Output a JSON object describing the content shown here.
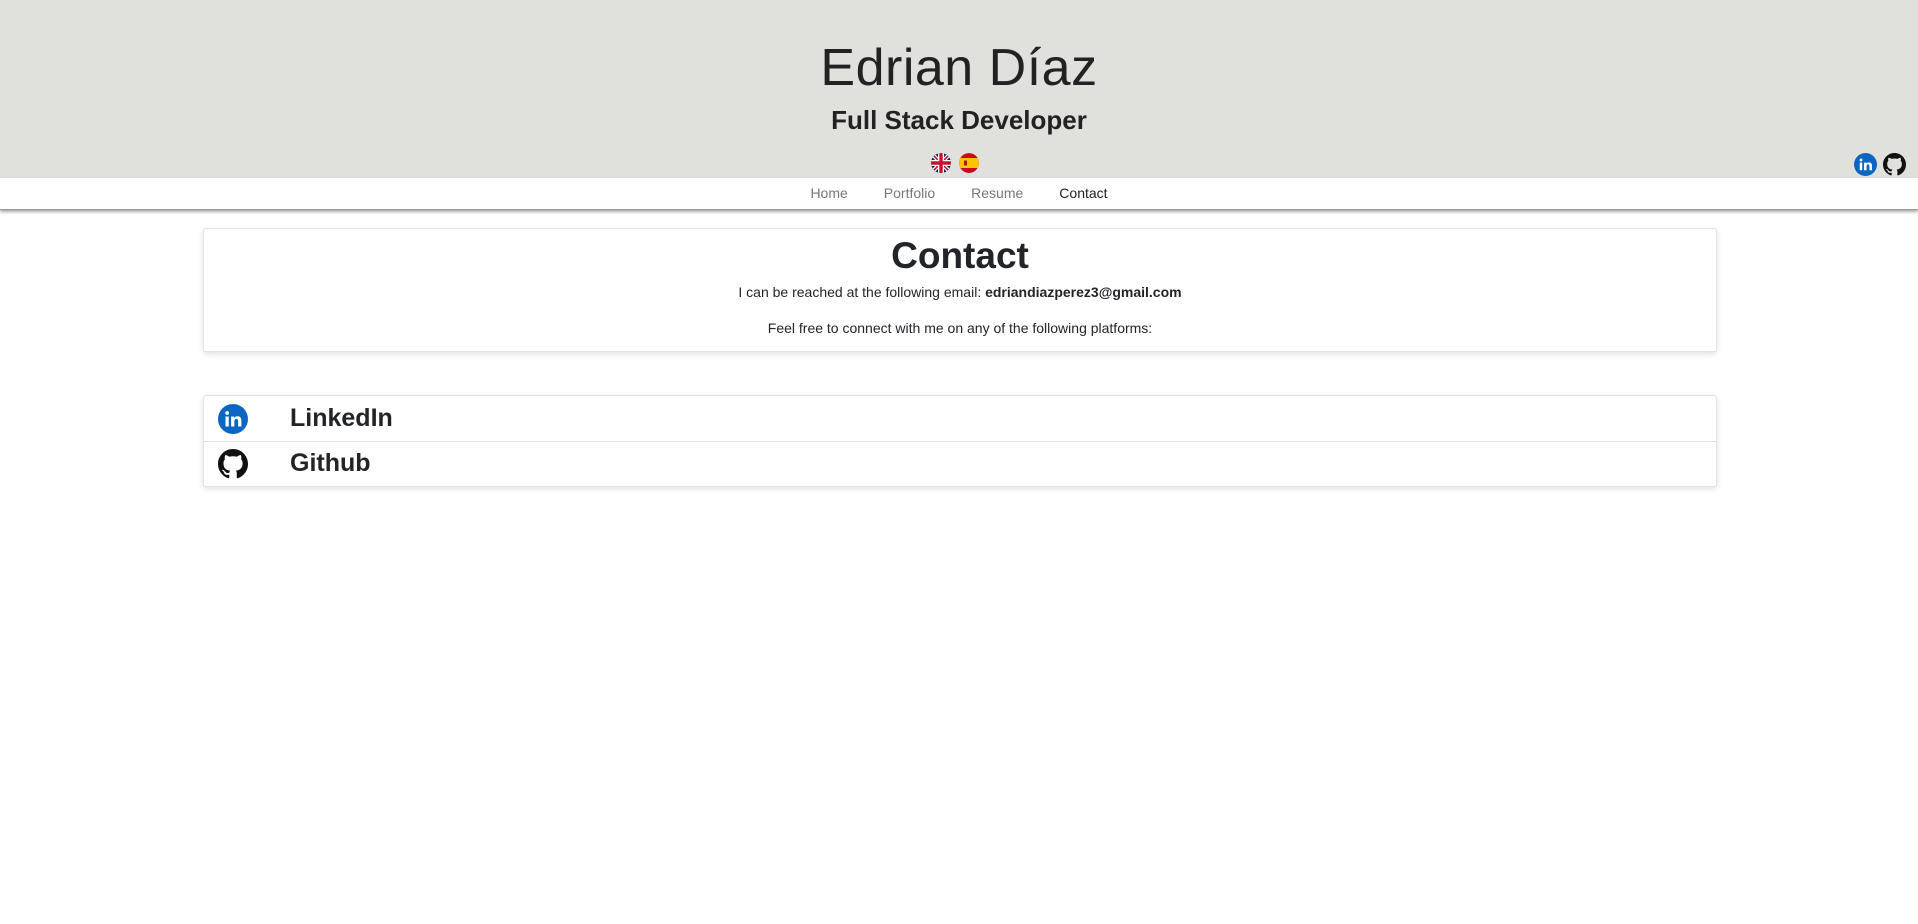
{
  "header": {
    "name": "Edrian Díaz",
    "role": "Full Stack Developer",
    "languages": [
      {
        "label": "English",
        "icon": "uk-flag-icon"
      },
      {
        "label": "Español",
        "icon": "spain-flag-icon"
      }
    ],
    "social": [
      {
        "label": "LinkedIn",
        "icon": "linkedin-icon",
        "color": "#0a66c2"
      },
      {
        "label": "Github",
        "icon": "github-icon",
        "color": "#111111"
      }
    ]
  },
  "nav": {
    "items": [
      {
        "label": "Home",
        "active": false
      },
      {
        "label": "Portfolio",
        "active": false
      },
      {
        "label": "Resume",
        "active": false
      },
      {
        "label": "Contact",
        "active": true
      }
    ]
  },
  "contact": {
    "title": "Contact",
    "email_prefix": "I can be reached at the following email: ",
    "email": "edriandiazperez3@gmail.com",
    "platforms_text": "Feel free to connect with me on any of the following platforms:"
  },
  "platforms": [
    {
      "label": "LinkedIn",
      "icon": "linkedin-icon"
    },
    {
      "label": "Github",
      "icon": "github-icon"
    }
  ],
  "colors": {
    "header_bg": "#e0e0dc",
    "linkedin": "#0a66c2",
    "github": "#111111",
    "text": "#212529",
    "nav_inactive": "#777777"
  }
}
